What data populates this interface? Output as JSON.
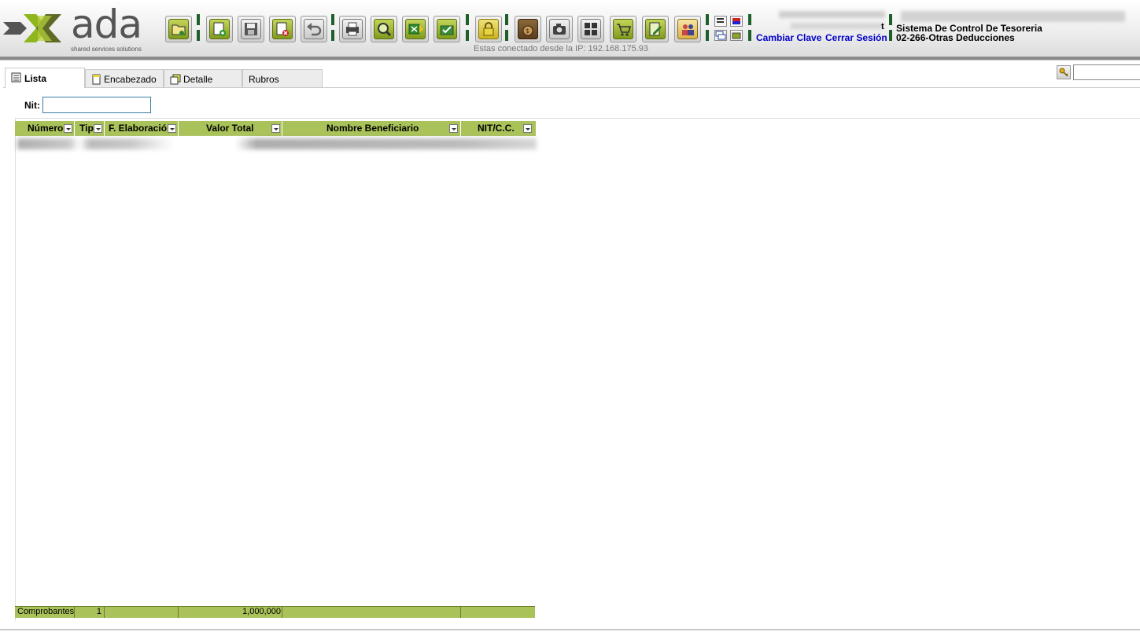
{
  "header": {
    "logo_text": "ada",
    "logo_tagline": "shared services solutions",
    "connection_info": "Estas conectado desde la IP: 192.168.175.93",
    "user_suffix": "t",
    "change_password": "Cambiar Clave",
    "logout": "Cerrar Sesión",
    "system_title": "Sistema De Control De Tesoreria",
    "document_title": "02-266-Otras Deducciones"
  },
  "toolbar": {
    "buttons": [
      "open-icon",
      "new-icon",
      "save-icon",
      "delete-icon",
      "undo-icon",
      "print-icon",
      "search-icon",
      "excel-export-icon",
      "approve-icon",
      "lock-icon",
      "money-bag-icon",
      "camera-icon",
      "grid-icon",
      "cart-icon",
      "edit-document-icon",
      "users-icon"
    ],
    "accent_color": "#8aa52b"
  },
  "tabs": [
    {
      "label": "Lista"
    },
    {
      "label": "Encabezado"
    },
    {
      "label": "Detalle"
    },
    {
      "label": "Rubros"
    }
  ],
  "filter": {
    "nit_label": "Nit:",
    "nit_value": ""
  },
  "grid": {
    "columns": [
      "Número",
      "Tip",
      "F. Elaboració",
      "Valor Total",
      "Nombre Beneficiario",
      "NIT/C.C."
    ],
    "footer": {
      "label": "Comprobantes",
      "count": "1",
      "total": "1,000,000"
    },
    "header_color": "#a9c25a"
  }
}
